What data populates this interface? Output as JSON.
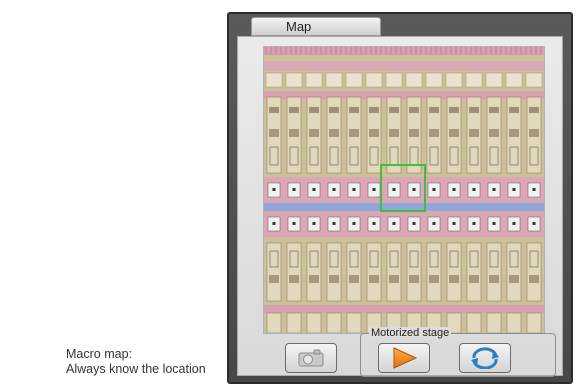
{
  "panel": {
    "tab_label": "Map"
  },
  "stage": {
    "label": "Motorized stage",
    "buttons": [
      {
        "name": "capture",
        "icon": "camera-icon"
      },
      {
        "name": "start",
        "icon": "play-icon",
        "accent": "#ee7a1a"
      },
      {
        "name": "refresh",
        "icon": "refresh-icon",
        "accent": "#2b7fc2"
      }
    ]
  },
  "map": {
    "marker_color": "#3fbf3f",
    "band_color": "#8fa7d8",
    "rail_color": "#d8a0ae"
  },
  "caption": {
    "line1": "Macro map:",
    "line2": "Always know the location"
  }
}
